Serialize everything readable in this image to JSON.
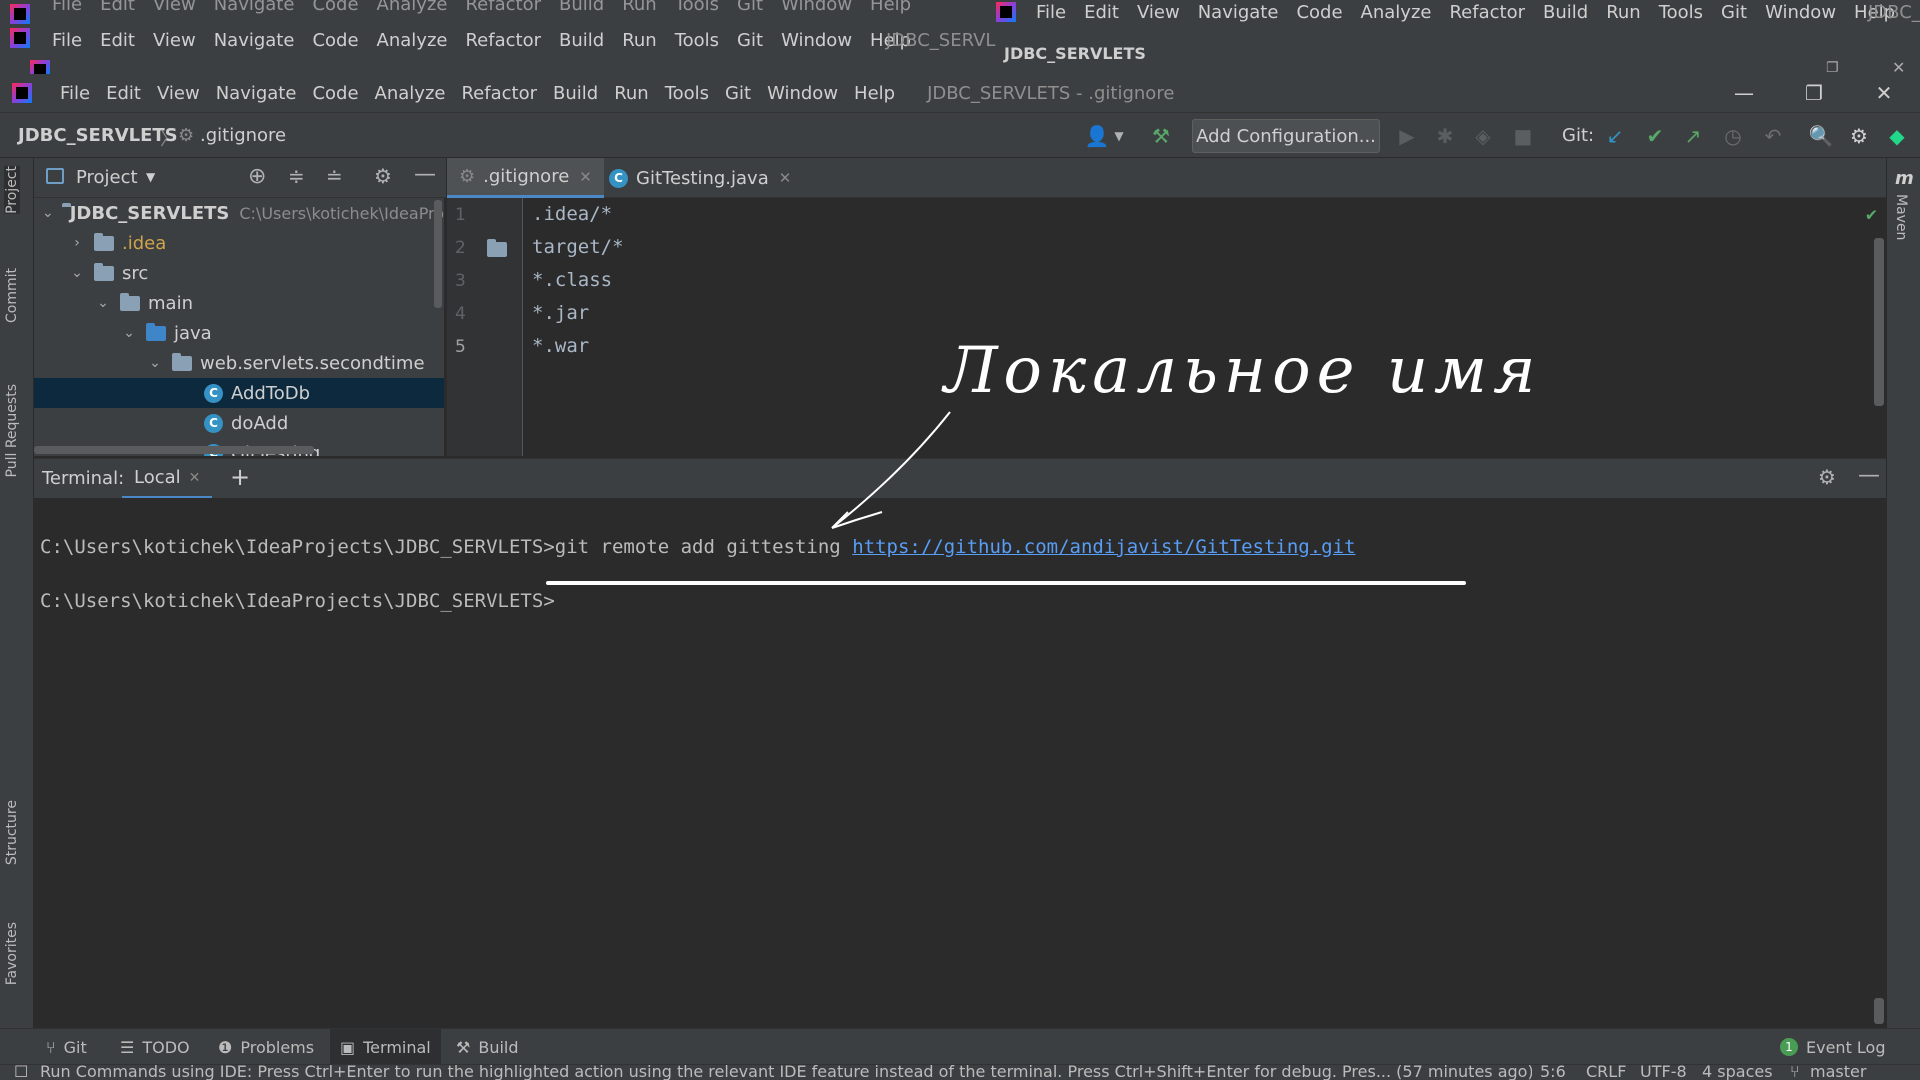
{
  "ghost_windows": {
    "menu_items": [
      "File",
      "Edit",
      "View",
      "Navigate",
      "Code",
      "Analyze",
      "Refactor",
      "Build",
      "Run",
      "Tools",
      "Git",
      "Window",
      "Help"
    ],
    "title_fragment": "JDBC_SERVL",
    "right_title_fragment": "JDBC_",
    "breadcrumb_fragment": "JDBC_SERVLETS"
  },
  "menubar": {
    "items": [
      "File",
      "Edit",
      "View",
      "Navigate",
      "Code",
      "Analyze",
      "Refactor",
      "Build",
      "Run",
      "Tools",
      "Git",
      "Window",
      "Help"
    ],
    "window_title": "JDBC_SERVLETS - .gitignore"
  },
  "window_controls": {
    "minimize": "—",
    "restore": "❐",
    "close": "✕"
  },
  "navbar": {
    "project": "JDBC_SERVLETS",
    "file": ".gitignore",
    "add_configuration": "Add Configuration...",
    "git_label": "Git:"
  },
  "left_stripe": {
    "tabs": [
      "Project",
      "Commit",
      "Pull Requests",
      "Structure",
      "Favorites"
    ]
  },
  "right_stripe": {
    "tabs": [
      "Maven"
    ]
  },
  "project_panel": {
    "title": "Project",
    "tree": [
      {
        "label": "JDBC_SERVLETS",
        "path": "C:\\Users\\kotichek\\IdeaPro",
        "kind": "root"
      },
      {
        "label": ".idea",
        "kind": "folder-collapsed",
        "color": "#d0a44c"
      },
      {
        "label": "src",
        "kind": "folder"
      },
      {
        "label": "main",
        "kind": "folder"
      },
      {
        "label": "java",
        "kind": "source-folder"
      },
      {
        "label": "web.servlets.secondtime",
        "kind": "package"
      },
      {
        "label": "AddToDb",
        "kind": "class",
        "selected": true
      },
      {
        "label": "doAdd",
        "kind": "class"
      },
      {
        "label": "GitTesting",
        "kind": "class"
      }
    ]
  },
  "editor": {
    "tabs": [
      {
        "label": ".gitignore",
        "active": true
      },
      {
        "label": "GitTesting.java",
        "active": false
      }
    ],
    "line_numbers": [
      "1",
      "2",
      "3",
      "4",
      "5"
    ],
    "lines": [
      ".idea/*",
      "target/*",
      "*.class",
      "*.jar",
      "*.war"
    ]
  },
  "terminal": {
    "label": "Terminal:",
    "tab": "Local",
    "lines": [
      {
        "prompt": "C:\\Users\\kotichek\\IdeaProjects\\JDBC_SERVLETS>",
        "command": "git remote add gittesting ",
        "link": "https://github.com/andijavist/GitTesting.git"
      },
      {
        "prompt": "C:\\Users\\kotichek\\IdeaProjects\\JDBC_SERVLETS>",
        "command": "",
        "link": ""
      }
    ]
  },
  "handwritten_note": "Локальное имя",
  "bottom_bar": {
    "tabs": [
      "Git",
      "TODO",
      "Problems",
      "Terminal",
      "Build"
    ],
    "active": "Terminal",
    "event_log": "Event Log",
    "event_count": "1"
  },
  "status_bar": {
    "message": "Run Commands using IDE: Press Ctrl+Enter to run the highlighted action using the relevant IDE feature instead of the terminal. Press Ctrl+Shift+Enter for debug. Pres... (57 minutes ago)",
    "position": "5:6",
    "line_ending": "CRLF",
    "encoding": "UTF-8",
    "indent": "4 spaces",
    "branch": "master"
  },
  "colors": {
    "accent": "#4a88c7",
    "selection": "#0d293e",
    "link": "#589df6",
    "git_update": "#3592c4",
    "git_commit": "#59a869",
    "git_push": "#59a869"
  }
}
